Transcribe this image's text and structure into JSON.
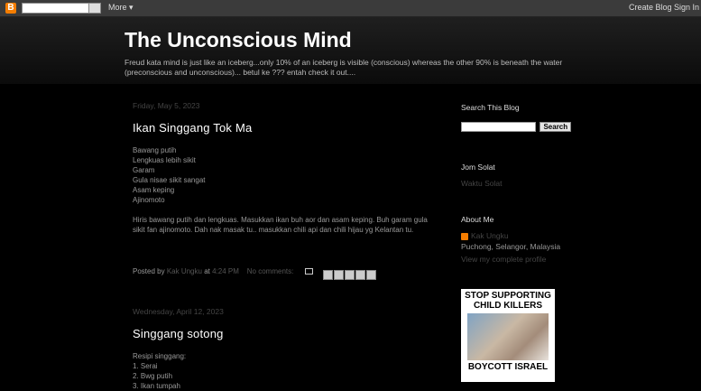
{
  "navbar": {
    "more_label": "More ▾",
    "create_label": "Create Blog",
    "signin_label": "Sign In"
  },
  "header": {
    "title": "The Unconscious Mind",
    "description": "Freud kata mind is just like an iceberg...only 10% of an iceberg is visible (conscious) whereas the other 90% is beneath the water (preconscious and unconscious)... betul ke ??? entah check it out...."
  },
  "posts": [
    {
      "date": "Friday, May 5, 2023",
      "title": "Ikan Singgang Tok Ma",
      "lines": [
        "Bawang putih",
        "Lengkuas lebih sikit",
        "Garam",
        "Gula nisae sikit sangat",
        "Asam keping",
        "Ajinomoto"
      ],
      "paragraph": "Hiris bawang putih dan lengkuas. Masukkan ikan buh aor dan asam keping. Buh garam gula sikit fan ajinomoto. Dah nak masak tu.. masukkan chili api dan chili hijau yg Kelantan tu.",
      "posted_by_label": "Posted by",
      "author": "Kak Ungku",
      "at_label": "at",
      "time": "4:24 PM",
      "comments": "No comments:"
    },
    {
      "date": "Wednesday, April 12, 2023",
      "title": "Singgang sotong",
      "lines": [
        "Resipi singgang:",
        "1. Serai",
        "2. Bwg putih",
        "3. Ikan tumpah"
      ]
    }
  ],
  "sidebar": {
    "search_title": "Search This Blog",
    "search_button": "Search",
    "jom_title": "Jom Solat",
    "jom_link": "Waktu Solat",
    "about_title": "About Me",
    "about_name": "Kak Ungku",
    "about_location": "Puchong, Selangor, Malaysia",
    "about_profile_link": "View my complete profile",
    "poster_top": "STOP SUPPORTING CHILD KILLERS",
    "poster_bottom": "BOYCOTT ISRAEL"
  }
}
